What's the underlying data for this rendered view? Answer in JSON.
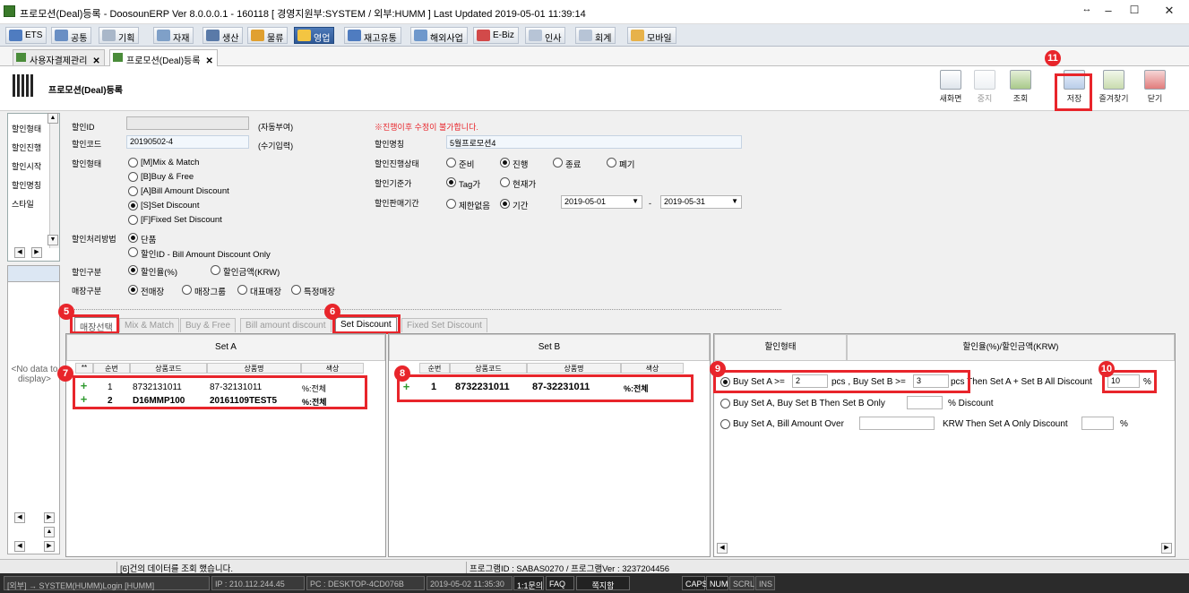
{
  "window": {
    "title": "프로모션(Deal)등록 - DoosounERP Ver 8.0.0.0.1 - 160118 [ 경영지원부:SYSTEM / 외부:HUMM ]    Last Updated 2019-05-01 11:39:14",
    "min": "–",
    "max": "☐",
    "close": "✕",
    "extra": "↔"
  },
  "menu": [
    "ETS",
    "공통",
    "기획",
    "자재",
    "생산",
    "물류",
    "영업",
    "재고유통",
    "해외사업",
    "E-Biz",
    "인사",
    "회계",
    "모바일"
  ],
  "doc_tabs": [
    "사용자결제관리",
    "프로모션(Deal)등록"
  ],
  "page_title": "프로모션(Deal)등록",
  "toolbar": [
    "새화면",
    "중지",
    "조회",
    "저장",
    "즐겨찾기",
    "닫기"
  ],
  "left_list": [
    "할인형태",
    "할인진행",
    "할인시작",
    "할인명칭",
    "스타일"
  ],
  "left_grid_empty": "<No data to display>",
  "form": {
    "id_label": "할인ID",
    "id_hint": "(자동부여)",
    "code_label": "할인코드",
    "code_value": "20190502-4",
    "code_hint": "(수기입력)",
    "warning": "※진행이후 수정이 불가합니다.",
    "type_label": "할인형태",
    "types": [
      "[M]Mix & Match",
      "[B]Buy & Free",
      "[A]Bill Amount Discount",
      "[S]Set Discount",
      "[F]Fixed Set Discount"
    ],
    "method_label": "할인처리방법",
    "methods": [
      "단품",
      "할인ID - Bill Amount Discount Only"
    ],
    "category_label": "할인구분",
    "categories": [
      "할인율(%)",
      "할인금액(KRW)"
    ],
    "store_label": "매장구분",
    "stores": [
      "전매장",
      "매장그룹",
      "대표매장",
      "특정매장"
    ],
    "name_label": "할인명칭",
    "name_value": "5월프로모션4",
    "status_label": "할인진행상태",
    "statuses": [
      "준비",
      "진행",
      "종료",
      "폐기"
    ],
    "basis_label": "할인기준가",
    "bases": [
      "Tag가",
      "현재가"
    ],
    "period_label": "할인판매기간",
    "periods": [
      "제한없음",
      "기간"
    ],
    "date_from": "2019-05-01",
    "date_sep": "-",
    "date_to": "2019-05-31"
  },
  "sub_tabs": [
    "매장선택",
    "Mix & Match",
    "Buy & Free",
    "Bill amount discount",
    "Set Discount",
    "Fixed Set Discount"
  ],
  "set_a": {
    "title": "Set A",
    "headers": [
      "**",
      "순번",
      "상품코드",
      "상품명",
      "색상"
    ],
    "rows": [
      {
        "no": "1",
        "code": "8732131011",
        "name": "87-32131011",
        "color": "%:전체"
      },
      {
        "no": "2",
        "code": "D16MMP100",
        "name": "20161109TEST5",
        "color": "%:전체"
      }
    ]
  },
  "set_b": {
    "title": "Set B",
    "headers": [
      "순번",
      "상품코드",
      "상품명",
      "색상"
    ],
    "rows": [
      {
        "no": "1",
        "code": "8732231011",
        "name": "87-32231011",
        "color": "%:전체"
      }
    ]
  },
  "discount": {
    "col1": "할인형태",
    "col2": "할인율(%)/할인금액(KRW)",
    "opt1_a": "Buy Set A >=",
    "opt1_v1": "2",
    "opt1_b": "pcs , Buy Set B >=",
    "opt1_v2": "3",
    "opt1_c": "pcs Then Set A + Set B All Discount",
    "opt1_v3": "10",
    "opt1_pct": "%",
    "opt2_a": "Buy Set A, Buy Set B Then Set B Only",
    "opt2_b": "% Discount",
    "opt3_a": "Buy Set A, Bill Amount Over",
    "opt3_b": "KRW Then Set A Only Discount",
    "opt3_pct": "%"
  },
  "badges": [
    "5",
    "6",
    "7",
    "8",
    "9",
    "10",
    "11"
  ],
  "status": {
    "message": "[6]건의 데이터를 조회 했습니다.",
    "program": "프로그램ID : SABAS0270 / 프로그램Ver : 3237204456"
  },
  "bottom": [
    "[외부] → SYSTEM(HUMM)Login [HUMM]",
    "IP : 210.112.244.45",
    "PC : DESKTOP-4CD076B",
    "2019-05-02 11:35:30",
    "1:1문의",
    "FAQ",
    "쪽지함",
    "CAPS",
    "NUM",
    "SCRL",
    "INS"
  ]
}
